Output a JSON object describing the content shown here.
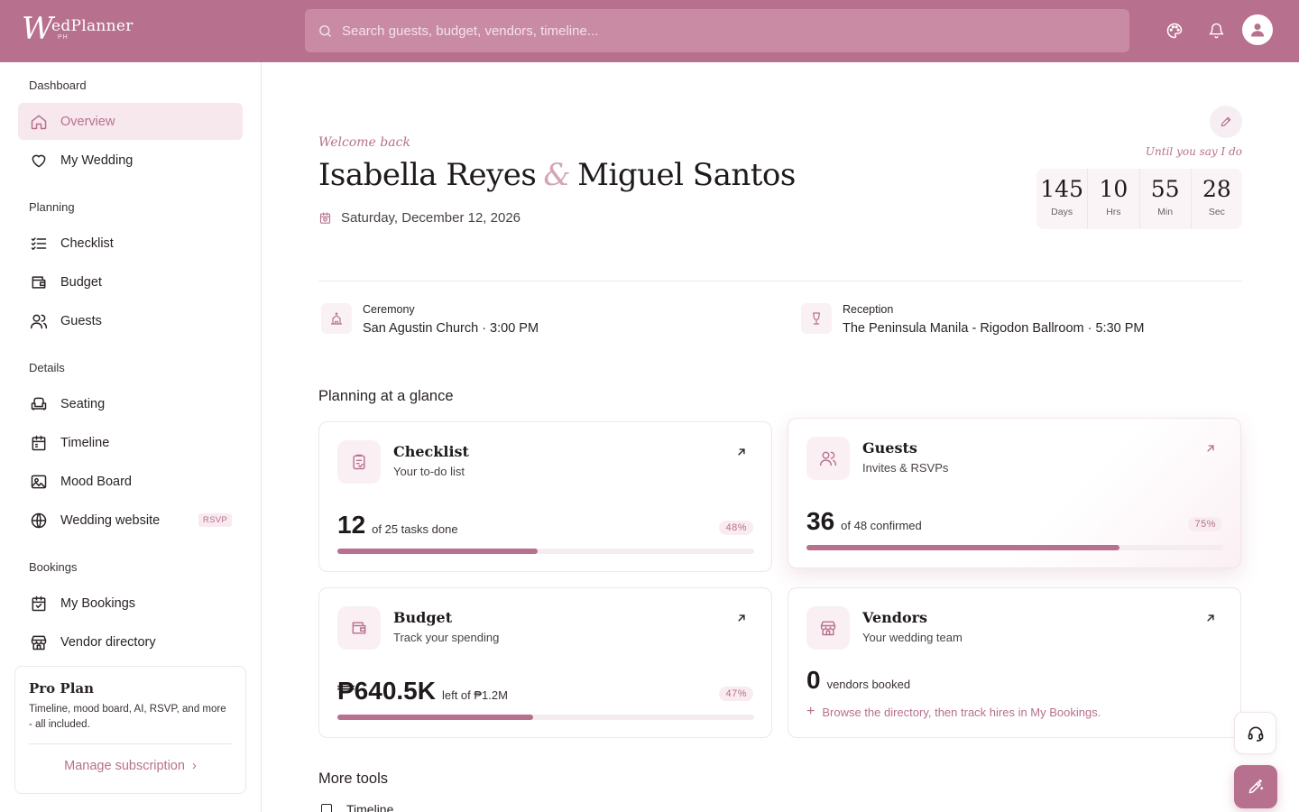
{
  "app": {
    "logo_mark": "W",
    "logo_word": "edPlanner",
    "logo_sub": "PH"
  },
  "header": {
    "search_placeholder": "Search guests, budget, vendors, timeline...",
    "icons": [
      "palette-icon",
      "bell-icon",
      "user-icon"
    ]
  },
  "sidebar": {
    "sections": [
      {
        "title": "Dashboard",
        "items": [
          {
            "label": "Overview",
            "icon": "home-icon",
            "active": true
          },
          {
            "label": "My Wedding",
            "icon": "heart-icon"
          }
        ]
      },
      {
        "title": "Planning",
        "items": [
          {
            "label": "Checklist",
            "icon": "checklist-icon"
          },
          {
            "label": "Budget",
            "icon": "wallet-icon"
          },
          {
            "label": "Guests",
            "icon": "users-icon"
          }
        ]
      },
      {
        "title": "Details",
        "items": [
          {
            "label": "Seating",
            "icon": "armchair-icon"
          },
          {
            "label": "Timeline",
            "icon": "calendar-icon"
          },
          {
            "label": "Mood Board",
            "icon": "image-icon"
          },
          {
            "label": "Wedding website",
            "icon": "globe-icon",
            "badge": "RSVP"
          }
        ]
      },
      {
        "title": "Bookings",
        "items": [
          {
            "label": "My Bookings",
            "icon": "calendar-check-icon"
          },
          {
            "label": "Vendor directory",
            "icon": "store-icon"
          }
        ]
      }
    ],
    "pro": {
      "title": "Pro Plan",
      "desc": "Timeline, mood board, AI, RSVP, and more - all included.",
      "cta": "Manage subscription",
      "cta_chevron": "›"
    }
  },
  "hero": {
    "welcome": "Welcome back",
    "partner1": "Isabella Reyes",
    "amp": "&",
    "partner2": "Miguel Santos",
    "date": "Saturday, December 12, 2026",
    "until": "Until you say I do",
    "countdown": [
      {
        "value": "145",
        "label": "Days"
      },
      {
        "value": "10",
        "label": "Hrs"
      },
      {
        "value": "55",
        "label": "Min"
      },
      {
        "value": "28",
        "label": "Sec"
      }
    ]
  },
  "venues": {
    "ceremony": {
      "title": "Ceremony",
      "value": "San Agustin Church · 3:00 PM"
    },
    "reception": {
      "title": "Reception",
      "value": "The Peninsula Manila - Rigodon Ballroom · 5:30 PM"
    }
  },
  "glance": {
    "title": "Planning at a glance",
    "cards": {
      "checklist": {
        "title": "Checklist",
        "sub": "Your to-do list",
        "num": "12",
        "unit": "of 25 tasks done",
        "pct": "48%",
        "progress": 0.48
      },
      "guests": {
        "title": "Guests",
        "sub": "Invites & RSVPs",
        "num": "36",
        "unit": "of 48 confirmed",
        "pct": "75%",
        "progress": 0.75
      },
      "budget": {
        "title": "Budget",
        "sub": "Track your spending",
        "num": "₱640.5K",
        "unit": "left of ₱1.2M",
        "pct": "47%",
        "progress": 0.47
      },
      "vendors": {
        "title": "Vendors",
        "sub": "Your wedding team",
        "num": "0",
        "unit": "vendors booked",
        "browse": "Browse the directory, then track hires in My Bookings."
      }
    }
  },
  "more": {
    "title": "More tools",
    "first_item": "Timeline"
  },
  "colors": {
    "brand": "#b7708e",
    "brand_light": "#f7e8ee",
    "text": "#2a2325"
  }
}
